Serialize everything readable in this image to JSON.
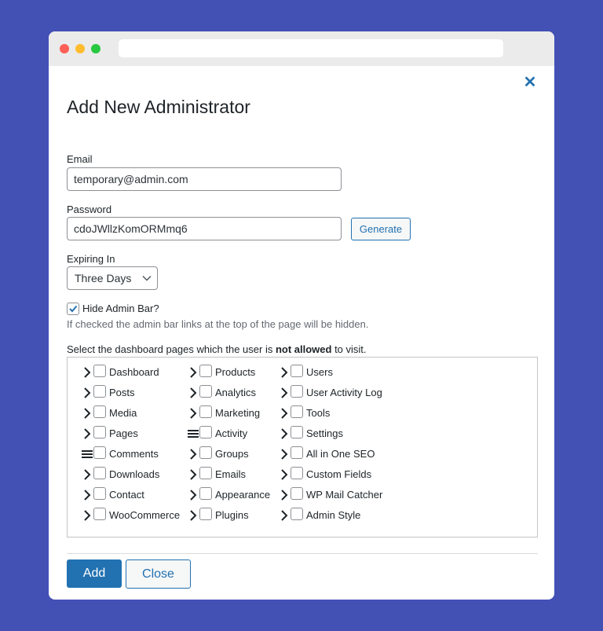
{
  "dialog": {
    "title": "Add New Administrator",
    "close_symbol": "✕"
  },
  "form": {
    "email_label": "Email",
    "email_value": "temporary@admin.com",
    "password_label": "Password",
    "password_value": "cdoJWllzKomORMmq6",
    "generate_label": "Generate",
    "expiring_label": "Expiring In",
    "expiring_value": "Three Days",
    "hide_admin_bar_label": "Hide Admin Bar?",
    "hide_admin_bar_checked": true,
    "hide_admin_bar_help": "If checked the admin bar links at the top of the page will be hidden.",
    "pages_instruction_before": "Select the dashboard pages which the user is ",
    "pages_instruction_bold": "not allowed",
    "pages_instruction_after": " to visit."
  },
  "pages": {
    "columns": [
      [
        {
          "label": "Dashboard",
          "icon": "chevron-right-icon"
        },
        {
          "label": "Posts",
          "icon": "chevron-right-icon"
        },
        {
          "label": "Media",
          "icon": "chevron-right-icon"
        },
        {
          "label": "Pages",
          "icon": "chevron-right-icon"
        },
        {
          "label": "Comments",
          "icon": "menu-lines-icon"
        },
        {
          "label": "Downloads",
          "icon": "chevron-right-icon"
        },
        {
          "label": "Contact",
          "icon": "chevron-right-icon"
        },
        {
          "label": "WooCommerce",
          "icon": "chevron-right-icon"
        }
      ],
      [
        {
          "label": "Products",
          "icon": "chevron-right-icon"
        },
        {
          "label": "Analytics",
          "icon": "chevron-right-icon"
        },
        {
          "label": "Marketing",
          "icon": "chevron-right-icon"
        },
        {
          "label": "Activity",
          "icon": "menu-lines-icon"
        },
        {
          "label": "Groups",
          "icon": "chevron-right-icon"
        },
        {
          "label": "Emails",
          "icon": "chevron-right-icon"
        },
        {
          "label": "Appearance",
          "icon": "chevron-right-icon"
        },
        {
          "label": "Plugins",
          "icon": "chevron-right-icon"
        }
      ],
      [
        {
          "label": "Users",
          "icon": "chevron-right-icon"
        },
        {
          "label": "User Activity Log",
          "icon": "chevron-right-icon"
        },
        {
          "label": "Tools",
          "icon": "chevron-right-icon"
        },
        {
          "label": "Settings",
          "icon": "chevron-right-icon"
        },
        {
          "label": "All in One SEO",
          "icon": "chevron-right-icon"
        },
        {
          "label": "Custom Fields",
          "icon": "chevron-right-icon"
        },
        {
          "label": "WP Mail Catcher",
          "icon": "chevron-right-icon"
        },
        {
          "label": "Admin Style",
          "icon": "chevron-right-icon"
        }
      ]
    ]
  },
  "buttons": {
    "add_label": "Add",
    "close_label": "Close"
  },
  "colors": {
    "background": "#4351b5",
    "accent": "#2271b1"
  }
}
